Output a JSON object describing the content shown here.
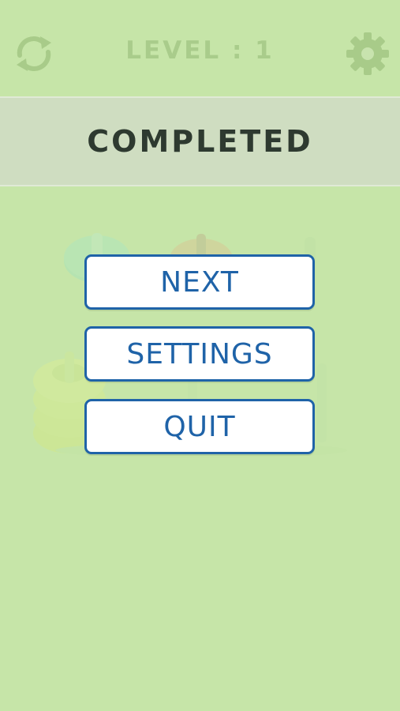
{
  "header": {
    "level_text": "LEVEL : 1",
    "restart_icon": "restart-icon",
    "settings_icon": "gear-icon"
  },
  "banner": {
    "title": "COMPLETED"
  },
  "menu": {
    "next_label": "NEXT",
    "settings_label": "SETTINGS",
    "quit_label": "QUIT"
  },
  "colors": {
    "background": "#c6e5a8",
    "button_border": "#1f63a8",
    "button_text": "#1f63a8",
    "banner_text": "#2e3a30",
    "header_faded": "#a9cc8b"
  }
}
